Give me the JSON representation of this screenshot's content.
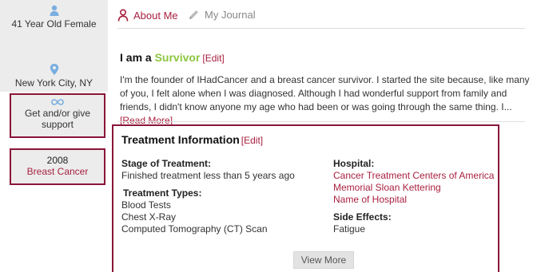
{
  "profile": {
    "age_gender": "41 Year Old Female",
    "location": "New York City, NY",
    "support": "Get and/or give support",
    "diagnosis_year": "2008",
    "diagnosis": "Breast Cancer"
  },
  "tabs": {
    "about": "About Me",
    "journal": "My Journal"
  },
  "survivor": {
    "prefix": "I am a ",
    "status": "Survivor",
    "edit": "[Edit]"
  },
  "bio": {
    "text": "I'm the founder of IHadCancer and a breast cancer survivor. I started the site because, like many of you, I felt alone when I was diagnosed. Although I had wonderful support from family and friends, I didn't know anyone my age who had been or was going through the same thing. I...",
    "read_more": "[Read More]"
  },
  "treatment": {
    "title": "Treatment Information",
    "edit": "[Edit]",
    "stage_label": "Stage of Treatment:",
    "stage_value": "Finished treatment less than 5 years ago",
    "types_label": "Treatment Types:",
    "types": [
      "Blood Tests",
      "Chest X-Ray",
      "Computed Tomography (CT) Scan"
    ],
    "hospital_label": "Hospital:",
    "hospitals": [
      "Cancer Treatment Centers of America",
      "Memorial Sloan Kettering",
      "Name of Hospital"
    ],
    "side_effects_label": "Side Effects:",
    "side_effects": [
      "Fatigue"
    ],
    "view_more": "View More"
  },
  "colors": {
    "accent": "#a8213f",
    "highlight_border": "#8b1538",
    "survivor_green": "#8cc63f",
    "icon_blue": "#7aaee0"
  },
  "icons": {
    "user": "user-icon",
    "location": "location-pin-icon",
    "support": "infinity-icon",
    "about_tab": "person-outline-icon",
    "journal_tab": "pencil-icon"
  }
}
